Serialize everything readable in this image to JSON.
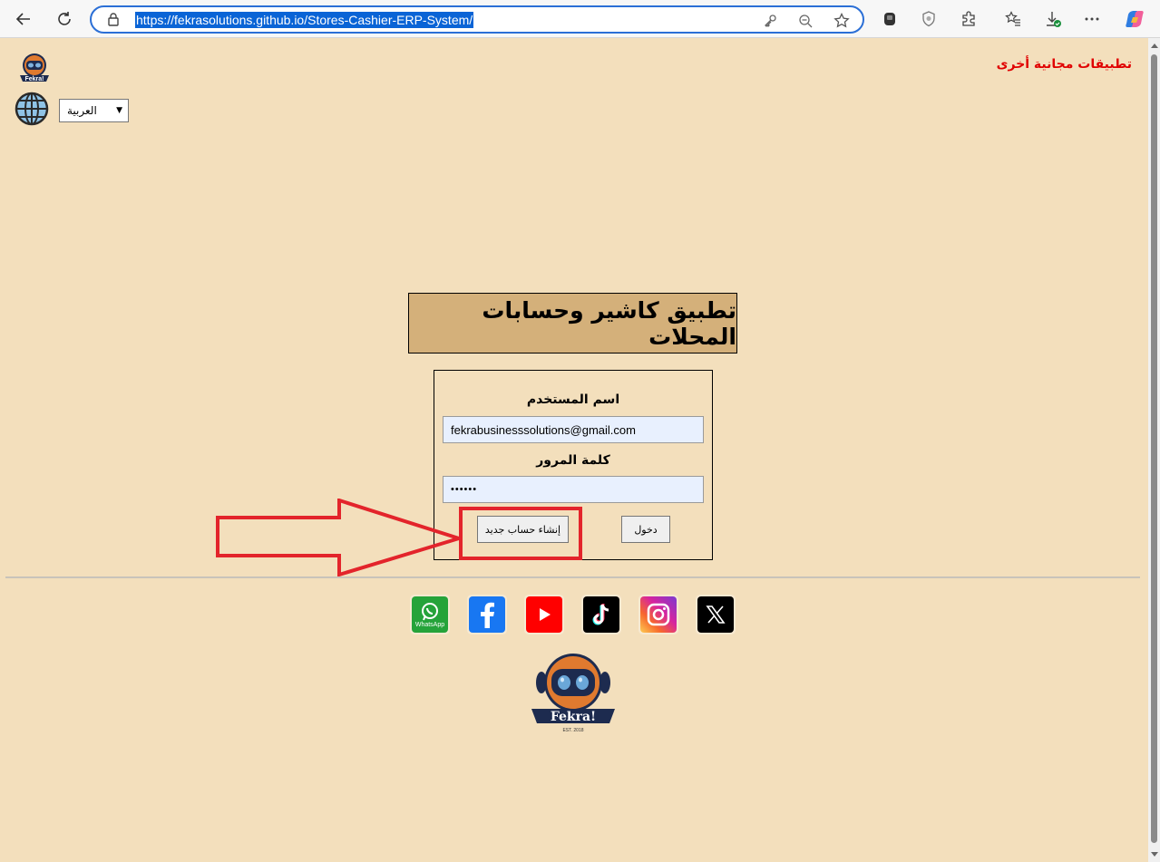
{
  "browser": {
    "url": "https://fekrasolutions.github.io/Stores-Cashier-ERP-System/"
  },
  "header": {
    "other_apps_link": "تطبيقات مجانية أخرى",
    "language_selected": "العربية"
  },
  "main": {
    "app_title": "تطبيق كاشير وحسابات المحلات",
    "username_label": "اسم المستخدم",
    "username_value": "fekrabusinesssolutions@gmail.com",
    "password_label": "كلمة المرور",
    "password_value": "••••••",
    "create_account_button": "إنشاء حساب جديد",
    "login_button": "دخول"
  },
  "footer": {
    "social_icons": [
      "whatsapp-icon",
      "facebook-icon",
      "youtube-icon",
      "tiktok-icon",
      "instagram-icon",
      "x-icon"
    ],
    "whatsapp_caption": "WhatsApp",
    "logo_text": "Fekra!",
    "logo_est": "EST. 2018"
  },
  "annotation": {
    "highlight_color": "#e3242b"
  }
}
